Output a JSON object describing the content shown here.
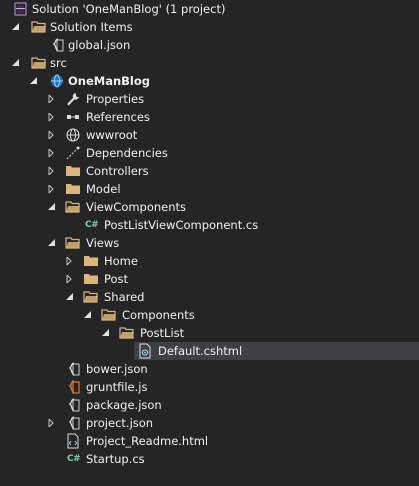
{
  "tree": {
    "solution_label": "Solution 'OneManBlog' (1 project)",
    "solution_items": "Solution Items",
    "global_json": "global.json",
    "src": "src",
    "project": "OneManBlog",
    "properties": "Properties",
    "references": "References",
    "wwwroot": "wwwroot",
    "dependencies": "Dependencies",
    "controllers": "Controllers",
    "model": "Model",
    "view_components": "ViewComponents",
    "post_list_vc": "PostListViewComponent.cs",
    "views": "Views",
    "home": "Home",
    "post": "Post",
    "shared": "Shared",
    "components": "Components",
    "post_list": "PostList",
    "default_cshtml": "Default.cshtml",
    "bower_json": "bower.json",
    "gruntfile_js": "gruntfile.js",
    "package_json": "package.json",
    "project_json": "project.json",
    "project_readme": "Project_Readme.html",
    "startup_cs": "Startup.cs"
  },
  "colors": {
    "background": "#252526",
    "text": "#f1f1f1",
    "selected_row": "#3f3f46",
    "folder": "#dcb67a",
    "csharp": "#7fd3a4",
    "grunt": "#e8742a"
  }
}
